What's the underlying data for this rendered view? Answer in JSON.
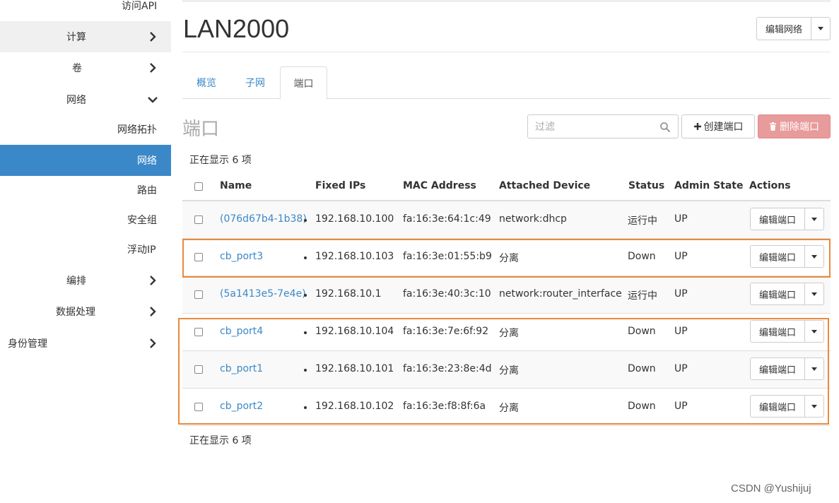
{
  "sidebar": {
    "items": [
      {
        "label": "访问API"
      },
      {
        "label": "计算"
      },
      {
        "label": "卷"
      },
      {
        "label": "网络"
      },
      {
        "label": "网络拓扑"
      },
      {
        "label": "网络"
      },
      {
        "label": "路由"
      },
      {
        "label": "安全组"
      },
      {
        "label": "浮动IP"
      },
      {
        "label": "编排"
      },
      {
        "label": "数据处理"
      },
      {
        "label": "身份管理"
      }
    ]
  },
  "header": {
    "title": "LAN2000",
    "edit_network_label": "编辑网络"
  },
  "tabs": [
    {
      "label": "概览"
    },
    {
      "label": "子网"
    },
    {
      "label": "端口"
    }
  ],
  "ports": {
    "section_title": "端口",
    "filter_placeholder": "过滤",
    "create_label": "创建端口",
    "delete_label": "删除端口",
    "count_text": "正在显示 6 项",
    "columns": [
      "Name",
      "Fixed IPs",
      "MAC Address",
      "Attached Device",
      "Status",
      "Admin State",
      "Actions"
    ],
    "action_label": "编辑端口",
    "rows": [
      {
        "name": "(076d67b4-1b38)",
        "ip": "192.168.10.100",
        "mac": "fa:16:3e:64:1c:49",
        "device": "network:dhcp",
        "status": "运行中",
        "admin": "UP"
      },
      {
        "name": "cb_port3",
        "ip": "192.168.10.103",
        "mac": "fa:16:3e:01:55:b9",
        "device": "分离",
        "status": "Down",
        "admin": "UP"
      },
      {
        "name": "(5a1413e5-7e4e)",
        "ip": "192.168.10.1",
        "mac": "fa:16:3e:40:3c:10",
        "device": "network:router_interface",
        "status": "运行中",
        "admin": "UP"
      },
      {
        "name": "cb_port4",
        "ip": "192.168.10.104",
        "mac": "fa:16:3e:7e:6f:92",
        "device": "分离",
        "status": "Down",
        "admin": "UP"
      },
      {
        "name": "cb_port1",
        "ip": "192.168.10.101",
        "mac": "fa:16:3e:23:8e:4d",
        "device": "分离",
        "status": "Down",
        "admin": "UP"
      },
      {
        "name": "cb_port2",
        "ip": "192.168.10.102",
        "mac": "fa:16:3e:f8:8f:6a",
        "device": "分离",
        "status": "Down",
        "admin": "UP"
      }
    ]
  },
  "watermark": "CSDN @Yushijuj",
  "colors": {
    "accent": "#3b88c8",
    "danger_button": "#e89b9b",
    "highlight_box": "#ea8a3c"
  }
}
